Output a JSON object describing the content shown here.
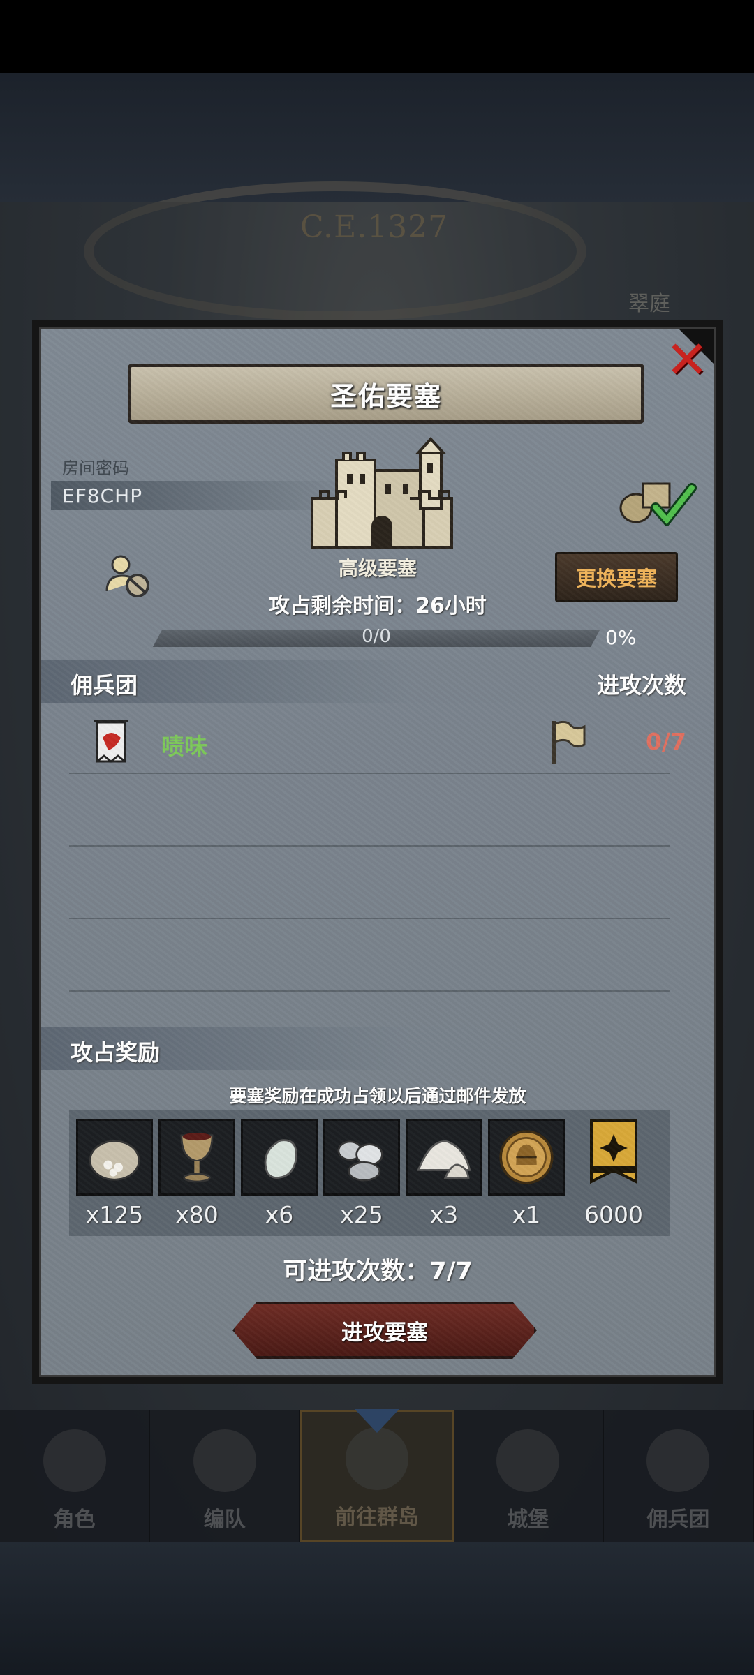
{
  "background": {
    "year": "C.E.1327",
    "right_label": "翠庭"
  },
  "bottom_nav": {
    "items": [
      {
        "label": "角色",
        "icon": "knight-helmet-icon"
      },
      {
        "label": "编队",
        "icon": "armored-knight-icon"
      },
      {
        "label": "前往群岛",
        "icon": "island-map-icon",
        "active": true
      },
      {
        "label": "城堡",
        "icon": "castle-icon"
      },
      {
        "label": "佣兵团",
        "icon": "mercenary-banner-icon"
      }
    ]
  },
  "modal": {
    "title": "圣佑要塞",
    "room_label": "房间密码",
    "room_code": "EF8CHP",
    "fort_type": "高级要塞",
    "time_left": "攻占剩余时间：26小时",
    "change_button": "更换要塞",
    "progress": {
      "text": "0/0",
      "percent_label": "0%",
      "fraction": 0
    },
    "mercenary_section": {
      "title": "佣兵团",
      "right": "进攻次数"
    },
    "mercenaries": [
      {
        "name": "啧味",
        "count": "0/7",
        "icon": "red-wolf-banner-icon"
      }
    ],
    "rewards_section": {
      "title": "攻占奖励",
      "note": "要塞奖励在成功占领以后通过邮件发放"
    },
    "rewards": [
      {
        "icon": "flour-sack-icon",
        "qty": "x125"
      },
      {
        "icon": "wine-goblet-icon",
        "qty": "x80"
      },
      {
        "icon": "moonstone-icon",
        "qty": "x6"
      },
      {
        "icon": "silver-ore-icon",
        "qty": "x25"
      },
      {
        "icon": "salt-pile-icon",
        "qty": "x3"
      },
      {
        "icon": "gold-helmet-coin-icon",
        "qty": "x1"
      },
      {
        "icon": "guild-emblem-icon",
        "qty": "6000"
      }
    ],
    "attempts": "可进攻次数：7/7",
    "attack_button": "进攻要塞"
  },
  "colors": {
    "merc_name": "#7dc95a",
    "merc_count": "#e07060",
    "change_button_text": "#f0b45a",
    "close_x": "#c8231f"
  }
}
